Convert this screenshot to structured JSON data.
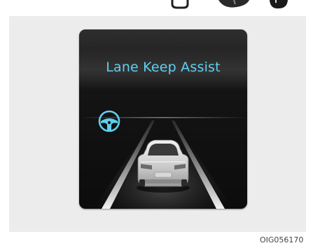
{
  "display": {
    "title": "Lane Keep Assist",
    "accent_color": "#5fd0f0",
    "indicator_icon": "steering-wheel-icon",
    "vehicle_icon": "car-rear-view-icon"
  },
  "figure": {
    "code": "OIG056170"
  }
}
